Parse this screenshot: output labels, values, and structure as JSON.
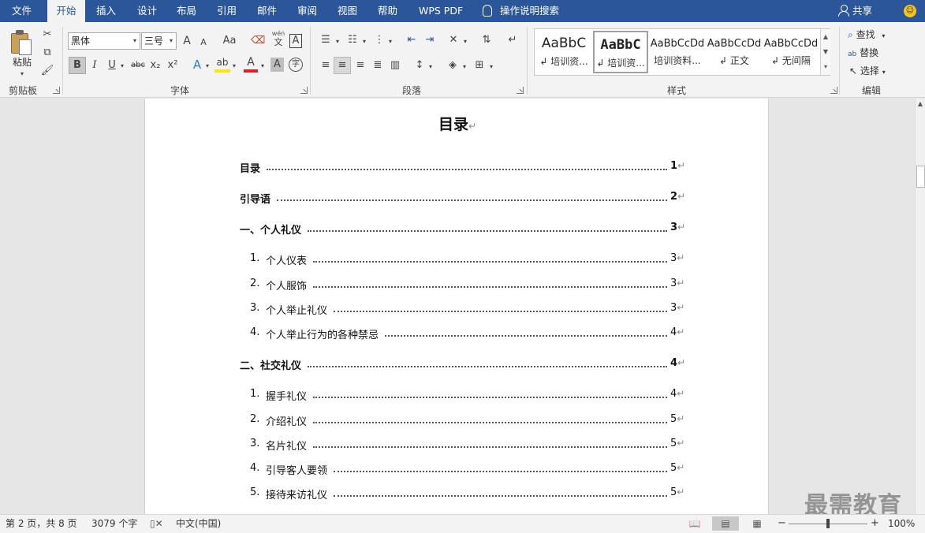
{
  "tabs": [
    {
      "label": "文件",
      "active": false
    },
    {
      "label": "开始",
      "active": true
    },
    {
      "label": "插入",
      "active": false
    },
    {
      "label": "设计",
      "active": false
    },
    {
      "label": "布局",
      "active": false
    },
    {
      "label": "引用",
      "active": false
    },
    {
      "label": "邮件",
      "active": false
    },
    {
      "label": "审阅",
      "active": false
    },
    {
      "label": "视图",
      "active": false
    },
    {
      "label": "帮助",
      "active": false
    },
    {
      "label": "WPS PDF",
      "active": false
    }
  ],
  "tell_me": "操作说明搜索",
  "share": "共享",
  "ribbon": {
    "clipboard": {
      "paste": "粘贴",
      "label": "剪贴板"
    },
    "font": {
      "font_name": "黑体",
      "font_size": "三号",
      "label": "字体",
      "glyphs": {
        "grow": "A",
        "shrink": "A",
        "case": "Aa",
        "phonetic_top": "wén",
        "phonetic_bottom": "文",
        "border": "A",
        "bold": "B",
        "italic": "I",
        "underline": "U",
        "strike": "abc",
        "sub": "x₂",
        "sup": "x²",
        "effects": "A",
        "highlight": "ab",
        "font_color": "A",
        "shade": "A",
        "enclose": "字"
      }
    },
    "paragraph": {
      "label": "段落"
    },
    "styles": {
      "label": "样式",
      "items": [
        {
          "sample": "AaBbC",
          "name": "培训资..."
        },
        {
          "sample": "AaBbC",
          "name": "培训资..."
        },
        {
          "sample": "AaBbCcDd",
          "name": "培训资料..."
        },
        {
          "sample": "AaBbCcDd",
          "name": "正文"
        },
        {
          "sample": "AaBbCcDd",
          "name": "无间隔"
        }
      ]
    },
    "editing": {
      "label": "编辑",
      "find": "查找",
      "replace": "替换",
      "select": "选择"
    }
  },
  "document": {
    "title": "目录",
    "toc": [
      {
        "text": "目录",
        "page": "1",
        "level": 1
      },
      {
        "text": "引导语",
        "page": "2",
        "level": 1
      },
      {
        "text": "一、个人礼仪",
        "page": "3",
        "level": 1
      },
      {
        "num": "1.",
        "text": "个人仪表",
        "page": "3",
        "level": 2
      },
      {
        "num": "2.",
        "text": "个人服饰",
        "page": "3",
        "level": 2
      },
      {
        "num": "3.",
        "text": "个人举止礼仪",
        "page": "3",
        "level": 2
      },
      {
        "num": "4.",
        "text": "个人举止行为的各种禁忌",
        "page": "4",
        "level": 2
      },
      {
        "text": "二、社交礼仪",
        "page": "4",
        "level": 1
      },
      {
        "num": "1.",
        "text": "握手礼仪",
        "page": "4",
        "level": 2
      },
      {
        "num": "2.",
        "text": "介绍礼仪",
        "page": "5",
        "level": 2
      },
      {
        "num": "3.",
        "text": "名片礼仪",
        "page": "5",
        "level": 2
      },
      {
        "num": "4.",
        "text": "引导客人要领",
        "page": "5",
        "level": 2
      },
      {
        "num": "5.",
        "text": "接待来访礼仪",
        "page": "5",
        "level": 2
      }
    ]
  },
  "status": {
    "page": "第 2 页，共 8 页",
    "words": "3079 个字",
    "language": "中文(中国)",
    "zoom": "100%",
    "zoom_level": 1.0
  },
  "watermark": "最需教育"
}
